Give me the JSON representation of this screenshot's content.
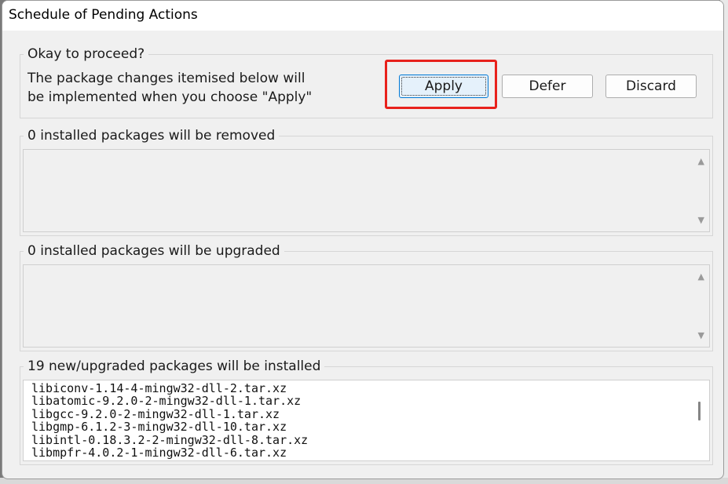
{
  "window": {
    "title": "Schedule of Pending Actions"
  },
  "proceed": {
    "legend": "Okay to proceed?",
    "line1": "The package changes itemised below will",
    "line2": "be implemented when you choose \"Apply\"",
    "apply_label": "Apply",
    "defer_label": "Defer",
    "discard_label": "Discard"
  },
  "removed": {
    "legend": "0 installed packages will be removed",
    "items": []
  },
  "upgraded": {
    "legend": "0 installed packages will be upgraded",
    "items": []
  },
  "installed": {
    "legend": "19 new/upgraded packages will be installed",
    "items": [
      "libiconv-1.14-4-mingw32-dll-2.tar.xz",
      "libatomic-9.2.0-2-mingw32-dll-1.tar.xz",
      "libgcc-9.2.0-2-mingw32-dll-1.tar.xz",
      "libgmp-6.1.2-3-mingw32-dll-10.tar.xz",
      "libintl-0.18.3.2-2-mingw32-dll-8.tar.xz",
      "libmpfr-4.0.2-1-mingw32-dll-6.tar.xz"
    ]
  },
  "colors": {
    "highlight": "#e8211b",
    "apply_focus": "#0078d4"
  },
  "icons": {
    "scroll_up": "scroll-up-arrow-icon",
    "scroll_down": "scroll-down-arrow-icon"
  }
}
